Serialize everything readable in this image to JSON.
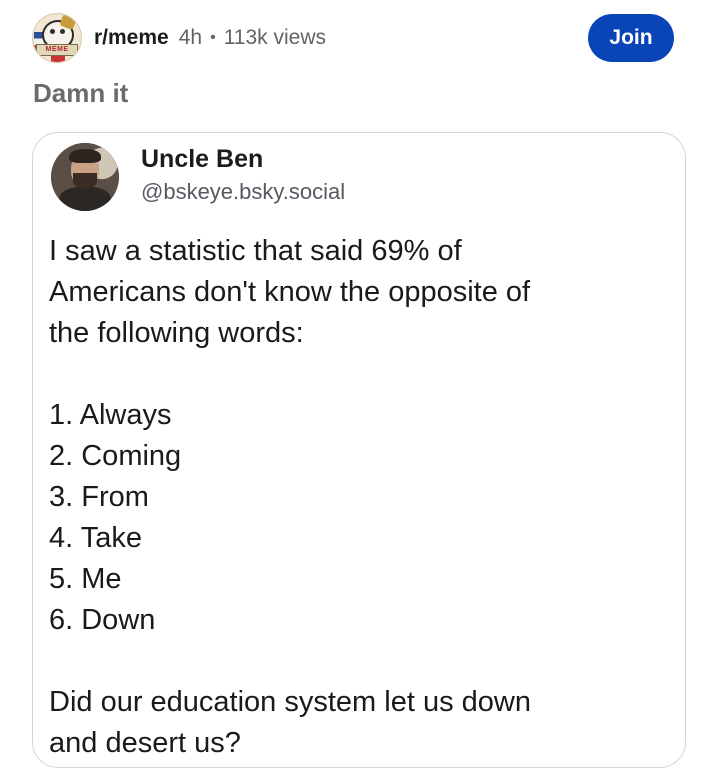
{
  "header": {
    "subreddit": "r/meme",
    "time_ago": "4h",
    "separator": "•",
    "views": "113k views",
    "join_label": "Join",
    "avatar_banner_text": "MEME"
  },
  "post": {
    "title": "Damn it"
  },
  "card": {
    "author_name": "Uncle Ben",
    "author_handle": "@bskeye.bsky.social",
    "intro_line_1": "I saw a statistic that said 69% of",
    "intro_line_2": "Americans don't know the opposite of",
    "intro_line_3": "the following words:",
    "items": [
      "1. Always",
      "2. Coming",
      "3. From",
      "4. Take",
      "5. Me",
      "6. Down"
    ],
    "closing_line_1": "Did our education system let us down",
    "closing_line_2": "and desert us?"
  },
  "colors": {
    "join_button": "#0a45b8",
    "title_gray": "#6b6b6b",
    "meta_gray": "#5f6368"
  }
}
